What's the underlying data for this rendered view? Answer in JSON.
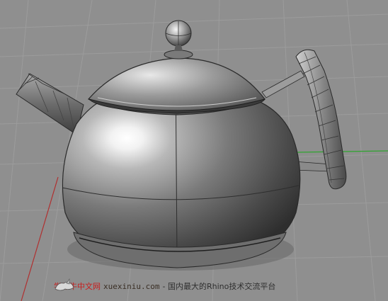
{
  "viewport": {
    "view": "Perspective",
    "background_color": "#8f8f8f",
    "grid_color": "#9a9a9a",
    "axis_colors": {
      "x": "#b03030",
      "y": "#2fa52f"
    },
    "model": "teapot",
    "display_mode": "shaded"
  },
  "watermark": {
    "logo_icon": "rhino-logo-icon",
    "brand": "学犀牛中文网",
    "site": "xuexiniu.com",
    "slogan": " - 国内最大的Rhino技术交流平台"
  }
}
